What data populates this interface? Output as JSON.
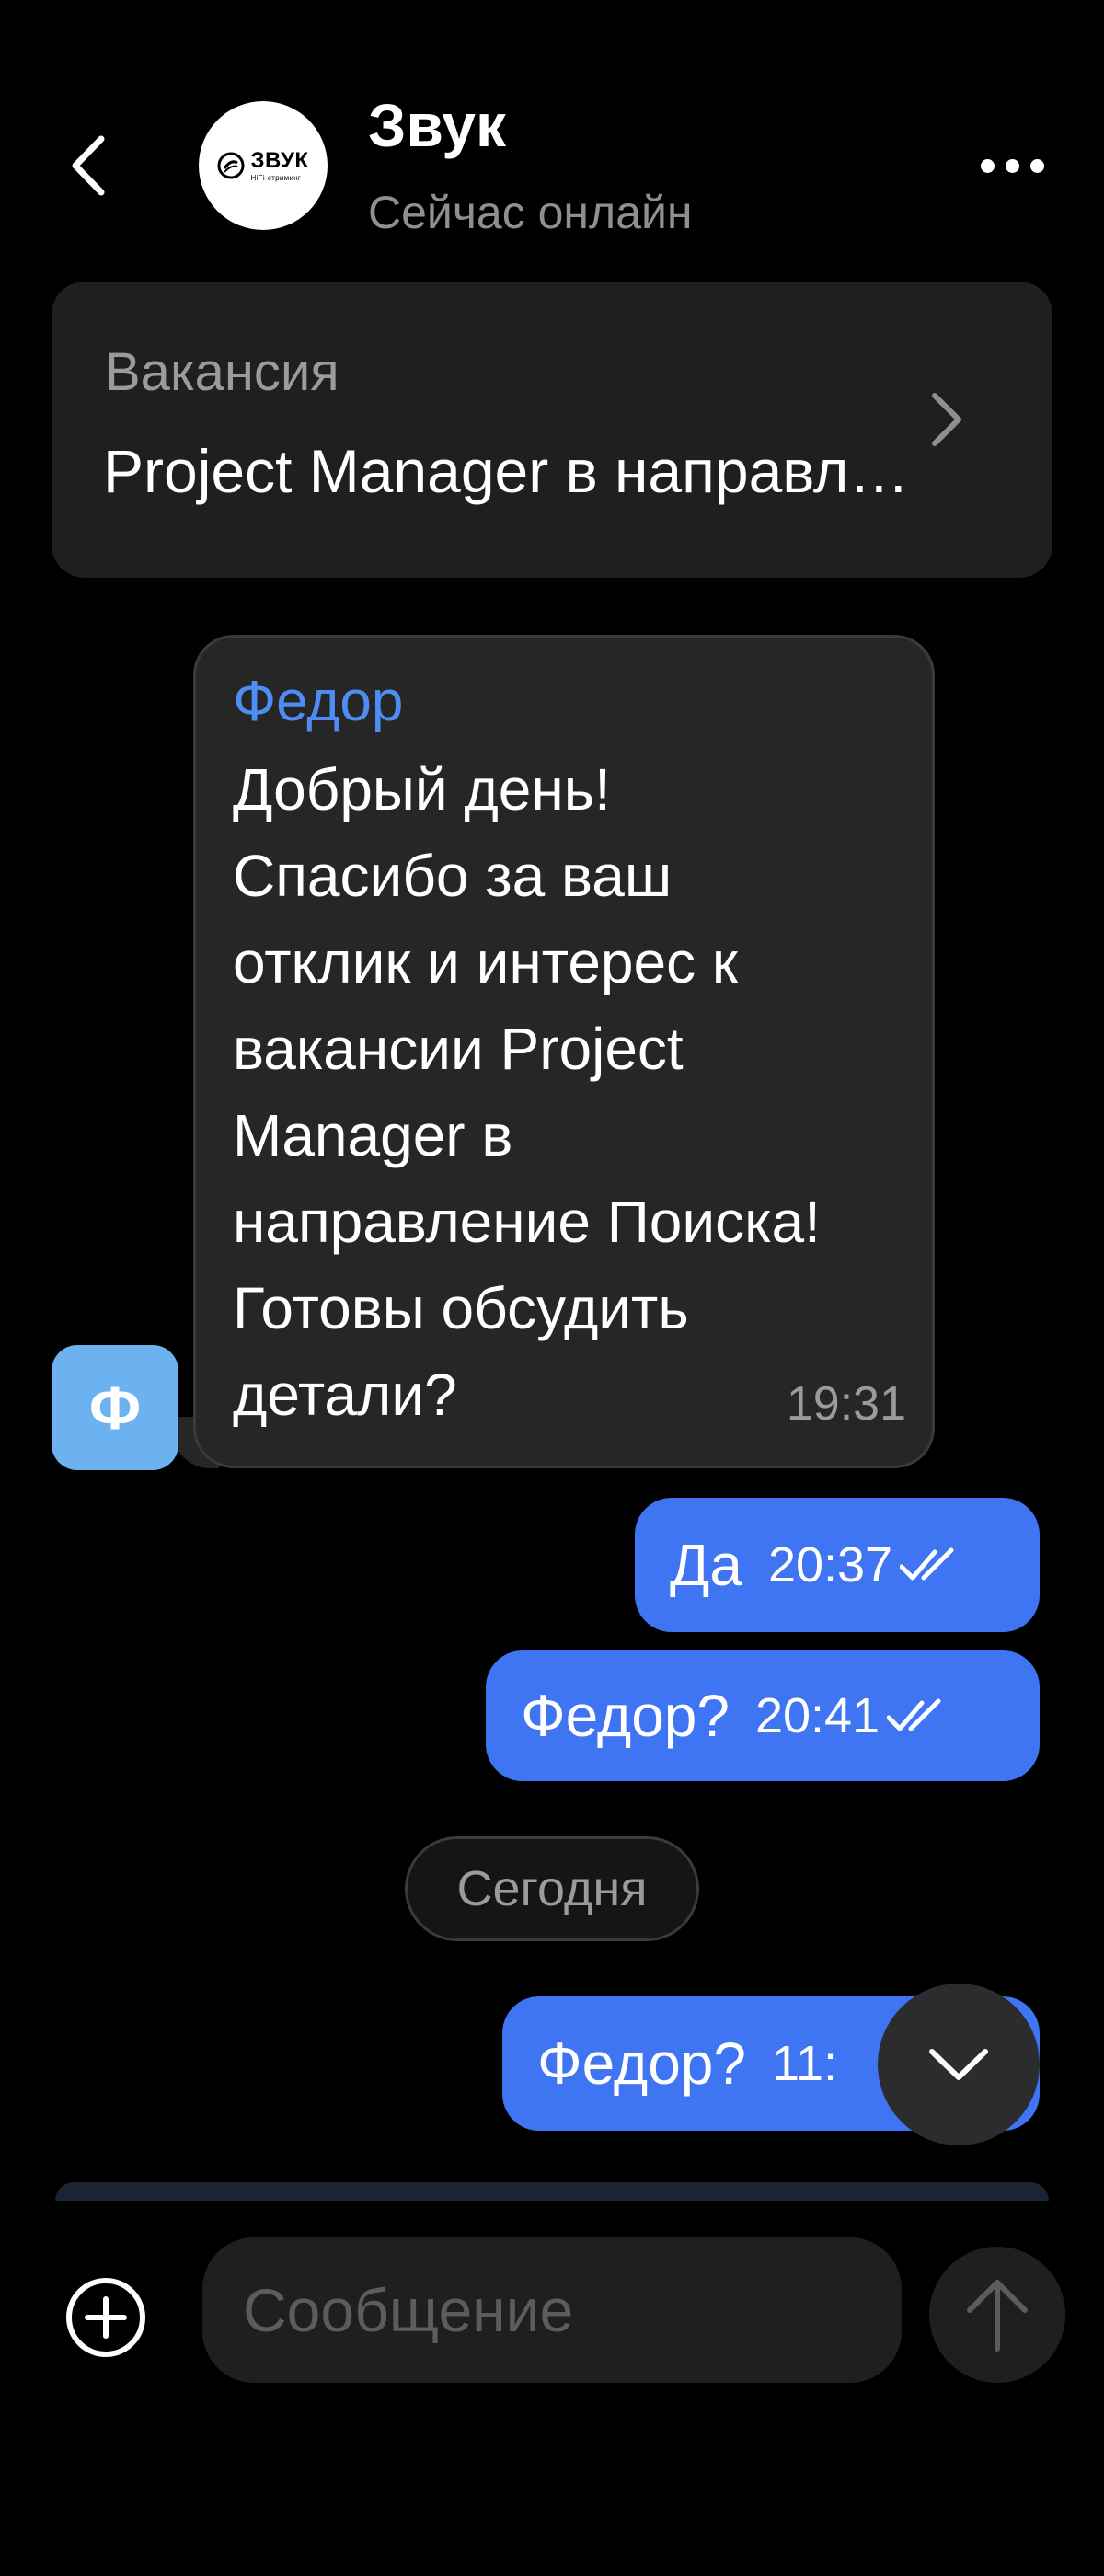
{
  "header": {
    "back_icon": "chevron-left-icon",
    "avatar_logo_text": "ЗВУК",
    "avatar_logo_subtext": "HiFi-стриминг",
    "title": "Звук",
    "status": "Сейчас онлайн",
    "more_icon": "more-horizontal-icon"
  },
  "vacancy": {
    "label": "Вакансия",
    "title": "Project Manager в направление Поиска",
    "chevron_icon": "chevron-right-icon"
  },
  "messages": [
    {
      "direction": "incoming",
      "sender": "Федор",
      "avatar_letter": "Ф",
      "text": "Добрый день!\nСпасибо за ваш\nотклик и интерес к\nвакансии Project\nManager в\nнаправление Поиска!\nГотовы обсудить\nдетали?",
      "time": "19:31"
    },
    {
      "direction": "outgoing",
      "text": "Да",
      "time": "20:37",
      "status_icon": "double-check-icon"
    },
    {
      "direction": "outgoing",
      "text": "Федор?",
      "time": "20:41",
      "status_icon": "double-check-icon"
    },
    {
      "direction": "outgoing",
      "text": "Федор?",
      "time": "11:",
      "status_icon": "double-check-icon"
    }
  ],
  "date_separator": "Сегодня",
  "scroll_down_icon": "chevron-down-icon",
  "composer": {
    "attach_icon": "plus-circle-icon",
    "placeholder": "Сообщение",
    "send_icon": "arrow-up-icon"
  },
  "colors": {
    "background": "#000000",
    "accent": "#3f74f3",
    "sender_name": "#4e8df5",
    "sender_avatar": "#6cb2f0",
    "surface": "#1f1f1f"
  }
}
